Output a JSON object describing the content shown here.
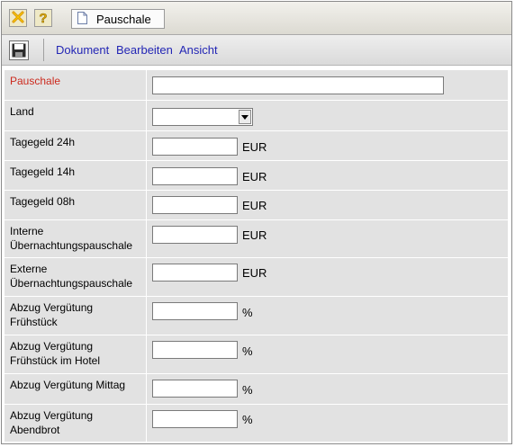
{
  "toolbar": {
    "close_icon": "close-x-icon",
    "help_icon": "help-question-icon",
    "tab_label": "Pauschale",
    "tab_icon": "document-icon"
  },
  "menubar": {
    "save_icon": "floppy-disk-icon",
    "items": [
      "Dokument",
      "Bearbeiten",
      "Ansicht"
    ]
  },
  "form": {
    "pauschale": {
      "label": "Pauschale",
      "value": "",
      "label_color": "#cc2a1e"
    },
    "land": {
      "label": "Land",
      "selected": ""
    },
    "fields": [
      {
        "label": "Tagegeld 24h",
        "value": "",
        "unit": "EUR"
      },
      {
        "label": "Tagegeld 14h",
        "value": "",
        "unit": "EUR"
      },
      {
        "label": "Tagegeld 08h",
        "value": "",
        "unit": "EUR"
      },
      {
        "label": "Interne Übernachtungspauschale",
        "value": "",
        "unit": "EUR"
      },
      {
        "label": "Externe Übernachtungspauschale",
        "value": "",
        "unit": "EUR"
      },
      {
        "label": "Abzug Vergütung Frühstück",
        "value": "",
        "unit": "%"
      },
      {
        "label": "Abzug Vergütung Frühstück im Hotel",
        "value": "",
        "unit": "%"
      },
      {
        "label": "Abzug Vergütung Mittag",
        "value": "",
        "unit": "%"
      },
      {
        "label": "Abzug Vergütung Abendbrot",
        "value": "",
        "unit": "%"
      }
    ]
  },
  "colors": {
    "link": "#2326b5",
    "label_required": "#cc2a1e",
    "row_bg": "#e2e2e2"
  }
}
